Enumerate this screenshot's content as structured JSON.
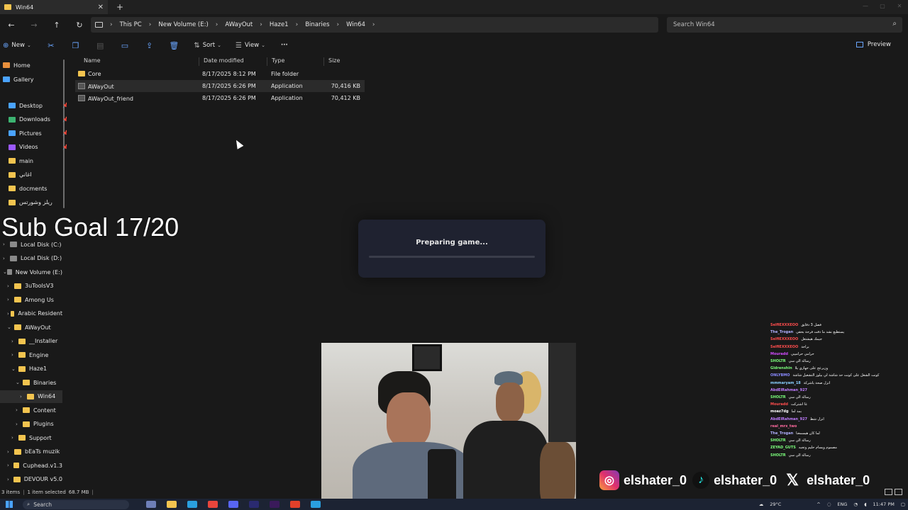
{
  "window": {
    "tab_title": "Win64",
    "tab_close": "✕",
    "new_tab": "+",
    "controls": [
      "—",
      "▢",
      "✕"
    ]
  },
  "address": {
    "crumbs": [
      "This PC",
      "New Volume (E:)",
      "AWayOut",
      "Haze1",
      "Binaries",
      "Win64"
    ],
    "search_placeholder": "Search Win64"
  },
  "toolbar": {
    "new_label": "New",
    "sort_label": "Sort",
    "view_label": "View",
    "more_label": "···",
    "preview_label": "Preview"
  },
  "sidebar": {
    "quick": [
      {
        "label": "Home",
        "icon": "home-icon",
        "color": "#e88f3c"
      },
      {
        "label": "Gallery",
        "icon": "gallery-icon",
        "color": "#4aa3ff"
      }
    ],
    "pinned": [
      {
        "label": "Desktop",
        "icon": "desktop-icon",
        "color": "#4aa3ff"
      },
      {
        "label": "Downloads",
        "icon": "download-icon",
        "color": "#3cb371"
      },
      {
        "label": "Pictures",
        "icon": "pictures-icon",
        "color": "#4aa3ff"
      },
      {
        "label": "Videos",
        "icon": "videos-icon",
        "color": "#9b59ff"
      },
      {
        "label": "main",
        "icon": "folder-icon",
        "color": "#f3c44f"
      },
      {
        "label": "اغاني",
        "icon": "folder-icon",
        "color": "#f3c44f"
      },
      {
        "label": "docments",
        "icon": "folder-icon",
        "color": "#f3c44f"
      },
      {
        "label": "ريلز وشورتس",
        "icon": "folder-icon",
        "color": "#f3c44f"
      }
    ],
    "tree": [
      {
        "label": "Local Disk (C:)",
        "indent": 0,
        "chev": "›"
      },
      {
        "label": "Local Disk (D:)",
        "indent": 0,
        "chev": "›"
      },
      {
        "label": "New Volume (E:)",
        "indent": 0,
        "chev": "⌄"
      },
      {
        "label": "3uToolsV3",
        "indent": 1,
        "chev": "›"
      },
      {
        "label": "Among Us",
        "indent": 1,
        "chev": "›"
      },
      {
        "label": "Arabic Resident",
        "indent": 1,
        "chev": "›"
      },
      {
        "label": "AWayOut",
        "indent": 1,
        "chev": "⌄"
      },
      {
        "label": "__Installer",
        "indent": 2,
        "chev": "›"
      },
      {
        "label": "Engine",
        "indent": 2,
        "chev": "›"
      },
      {
        "label": "Haze1",
        "indent": 2,
        "chev": "⌄"
      },
      {
        "label": "Binaries",
        "indent": 3,
        "chev": "⌄"
      },
      {
        "label": "Win64",
        "indent": 4,
        "chev": "›"
      },
      {
        "label": "Content",
        "indent": 3,
        "chev": "›"
      },
      {
        "label": "Plugins",
        "indent": 3,
        "chev": "›"
      },
      {
        "label": "Support",
        "indent": 2,
        "chev": "›"
      },
      {
        "label": "bEaTs muzik",
        "indent": 1,
        "chev": "›"
      },
      {
        "label": "Cuphead.v1.3",
        "indent": 1,
        "chev": "›"
      },
      {
        "label": "DEVOUR v5.0",
        "indent": 1,
        "chev": "›"
      }
    ]
  },
  "files": {
    "columns": [
      "Name",
      "Date modified",
      "Type",
      "Size"
    ],
    "rows": [
      {
        "name": "Core",
        "date": "8/17/2025 8:12 PM",
        "type": "File folder",
        "size": "",
        "kind": "folder"
      },
      {
        "name": "AWayOut",
        "date": "8/17/2025 6:26 PM",
        "type": "Application",
        "size": "70,416 KB",
        "kind": "app"
      },
      {
        "name": "AWayOut_friend",
        "date": "8/17/2025 6:26 PM",
        "type": "Application",
        "size": "70,412 KB",
        "kind": "app"
      }
    ]
  },
  "status": {
    "items": "3 items",
    "selected": "1 item selected",
    "size": "68.7 MB"
  },
  "overlay": {
    "sub_goal": "Sub Goal 17/20",
    "preparing": "Preparing game...",
    "progress": 0
  },
  "chat": [
    {
      "user": "SelfiEXXXEOO",
      "msg": "فضل 3 دقايق",
      "color": "#ff4d4d"
    },
    {
      "user": "The_Trogan",
      "msg": "يستطيع نشد ما ذقت فرحة بحقي",
      "color": "#b0b0ff"
    },
    {
      "user": "SelfiEXXXEOO",
      "msg": "جيمك هيشتغل",
      "color": "#ff4d4d"
    },
    {
      "user": "SelfiEXXXEOO",
      "msg": "براحة",
      "color": "#ff4d4d"
    },
    {
      "user": "Mouradd",
      "msg": "حرامي حرامييي",
      "color": "#d34dff"
    },
    {
      "user": "SHOLTR",
      "msg": "رسالة الي سي",
      "color": "#7cff7c"
    },
    {
      "user": "Gldrenshin",
      "msg": "وزيرعج على جهازي يلا",
      "color": "#7cff7c"
    },
    {
      "user": "ONLYBMO",
      "msg": "كونت الشغل على كونت حد شاشة لي بيلوز التشغيل شاشة",
      "color": "#8a8aff"
    },
    {
      "user": "mmmaryam_18",
      "msg": "انزل صحة ياشركة",
      "color": "#8ad0ff"
    },
    {
      "user": "AbdElRahman_927",
      "msg": "",
      "color": "#c07cff"
    },
    {
      "user": "SHOLTR",
      "msg": "رسالة الي سي",
      "color": "#7cff7c"
    },
    {
      "user": "Mouradd",
      "msg": "غا اشتركت",
      "color": "#ff4d4d"
    },
    {
      "user": "moaz7dg",
      "msg": "بمد لما",
      "color": "#ffffff"
    },
    {
      "user": "AbdElRahman_927",
      "msg": "انزل شط",
      "color": "#c07cff"
    },
    {
      "user": "real_mrx_two",
      "msg": "",
      "color": "#ff6aa0"
    },
    {
      "user": "The_Trogan",
      "msg": "لما كان هيسمعنا",
      "color": "#b0b0ff"
    },
    {
      "user": "SHOLTR",
      "msg": "رسالة الي سي",
      "color": "#7cff7c"
    },
    {
      "user": "ZEYAD_GUTS",
      "msg": "مصموم ويسام حليم وتجيه",
      "color": "#7cff7c"
    },
    {
      "user": "SHOLTR",
      "msg": "رسالة الي سي",
      "color": "#7cff7c"
    }
  ],
  "social": {
    "instagram": "elshater_0",
    "tiktok": "elshater_0",
    "x": "elshater_0"
  },
  "taskbar": {
    "search": "Search",
    "weather": "29°C",
    "lang": "ENG",
    "time": "11:47 PM"
  }
}
